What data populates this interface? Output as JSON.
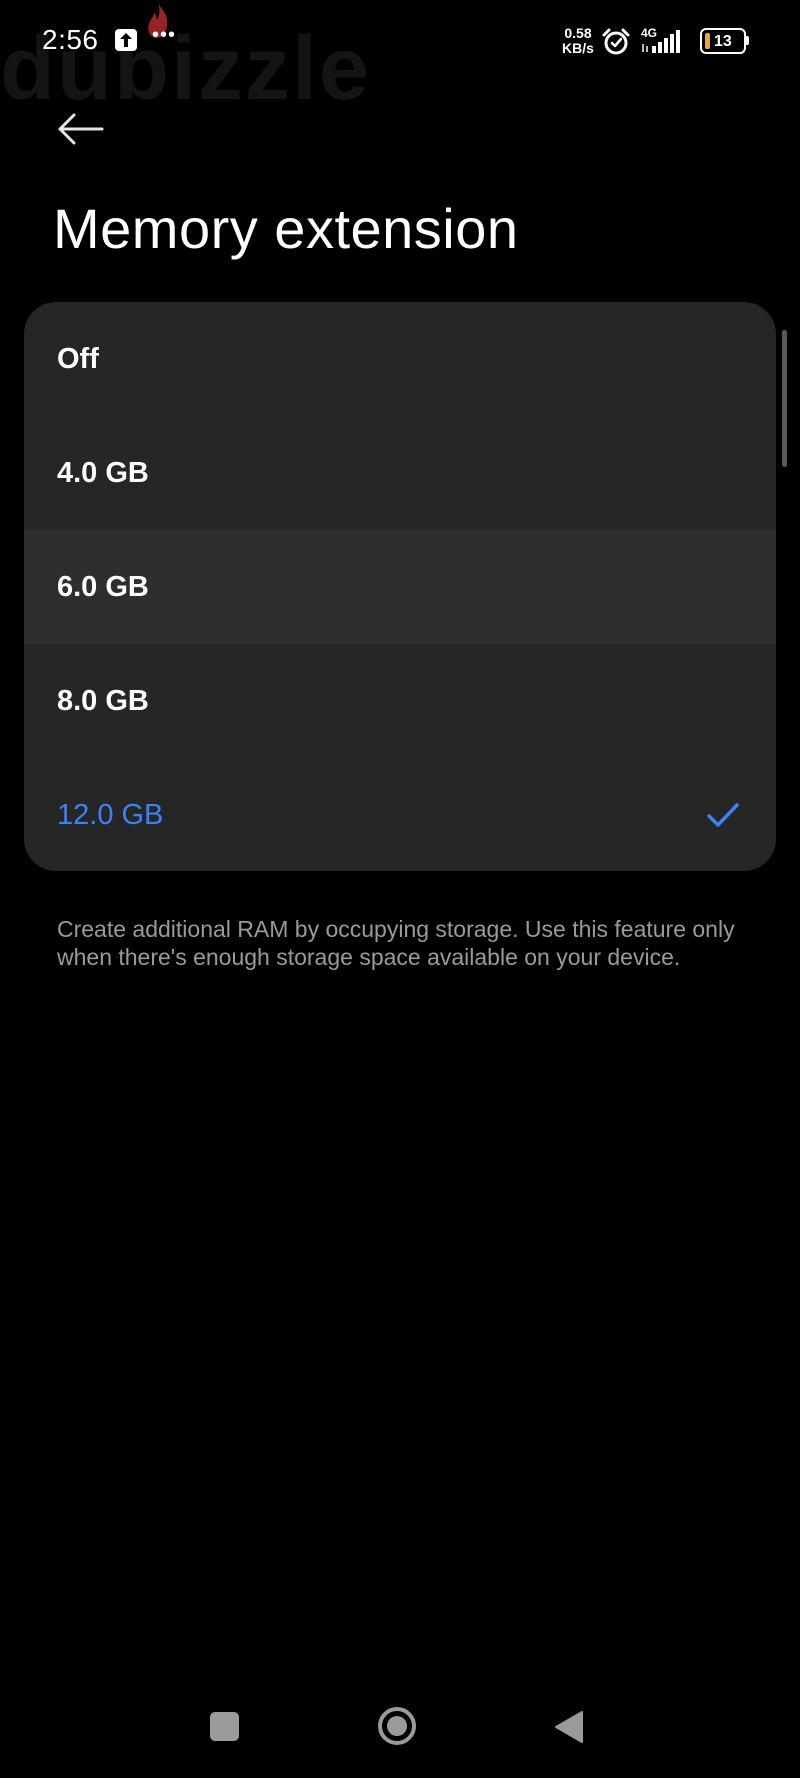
{
  "status_bar": {
    "time": "2:56",
    "notification_more": "•••",
    "net_speed_value": "0.58",
    "net_speed_unit": "KB/s",
    "network_type": "4G",
    "battery_level": "13",
    "battery_color": "#e8a93a"
  },
  "watermark": {
    "text": "dubizzle",
    "flame_color": "#b22a2a"
  },
  "header": {
    "back_icon": "arrow-left-icon",
    "title": "Memory extension"
  },
  "options": {
    "items": [
      {
        "label": "Off",
        "selected": false
      },
      {
        "label": "4.0 GB",
        "selected": false
      },
      {
        "label": "6.0 GB",
        "selected": false
      },
      {
        "label": "8.0 GB",
        "selected": false
      },
      {
        "label": "12.0 GB",
        "selected": true
      }
    ],
    "selected_color": "#3b82f6",
    "check_icon": "checkmark-icon"
  },
  "description": "Create additional RAM by occupying storage. Use this feature only when there's enough storage space available on your device.",
  "nav_bar": {
    "recents_icon": "square-icon",
    "home_icon": "circle-icon",
    "back_icon": "triangle-back-icon"
  }
}
